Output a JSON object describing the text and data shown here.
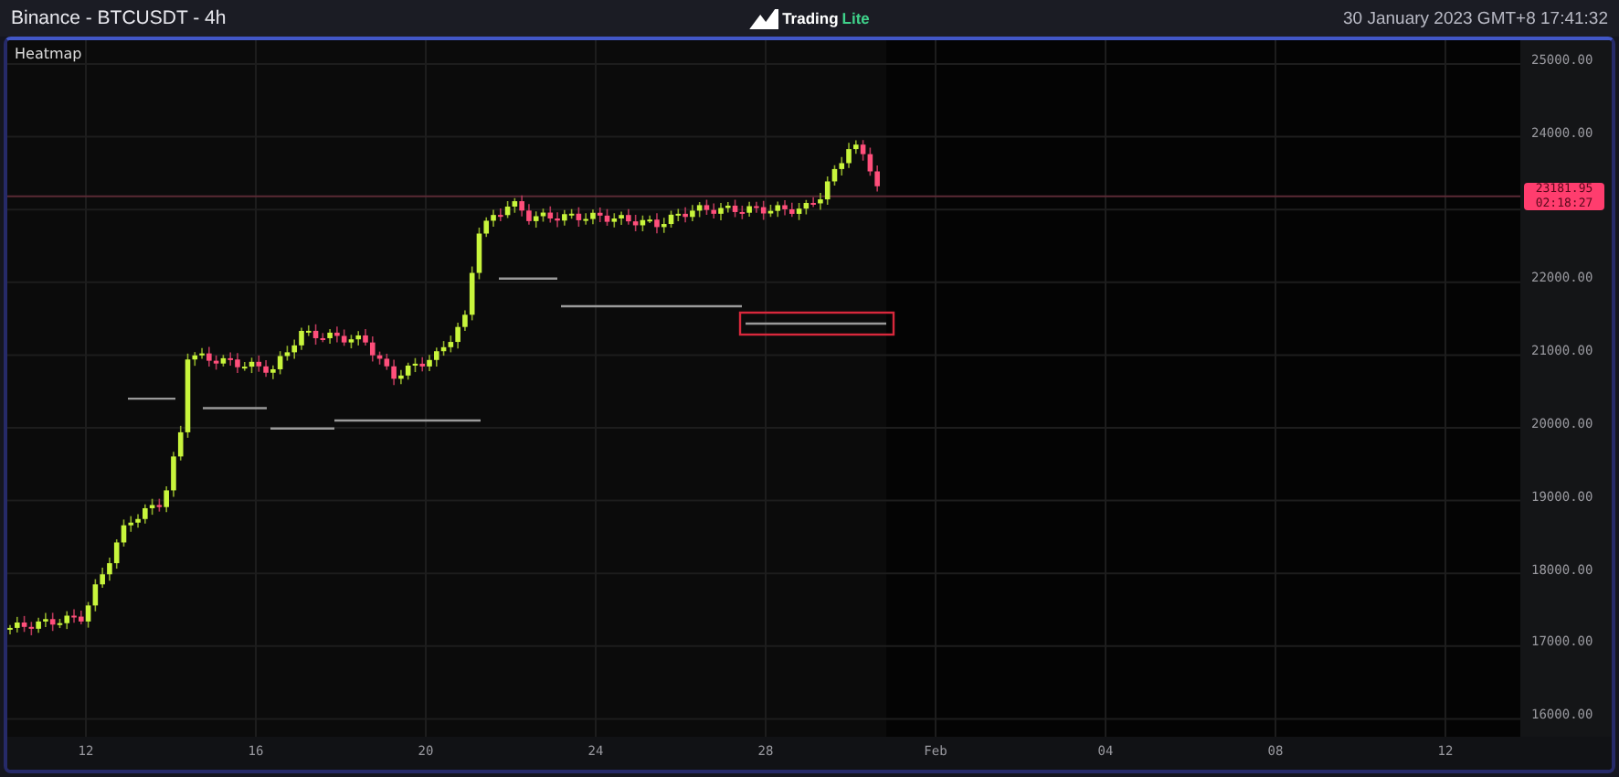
{
  "header": {
    "title": "Binance - BTCUSDT - 4h",
    "logo": {
      "word": "Trading",
      "accent": "Lite"
    },
    "datetime": "30 January 2023 GMT+8 17:41:32"
  },
  "chart": {
    "label": "Heatmap",
    "price_axis_upper": [
      "25000.00",
      "24000.00"
    ],
    "price_axis_lower": [
      "22000.00",
      "21000.00",
      "20000.00",
      "19000.00",
      "18000.00",
      "17000.00",
      "16000.00"
    ],
    "time_axis": [
      "12",
      "16",
      "20",
      "24",
      "28",
      "Feb",
      "04",
      "08",
      "12"
    ],
    "last_price": {
      "price": "23181.95",
      "countdown": "02:18:27"
    }
  }
}
